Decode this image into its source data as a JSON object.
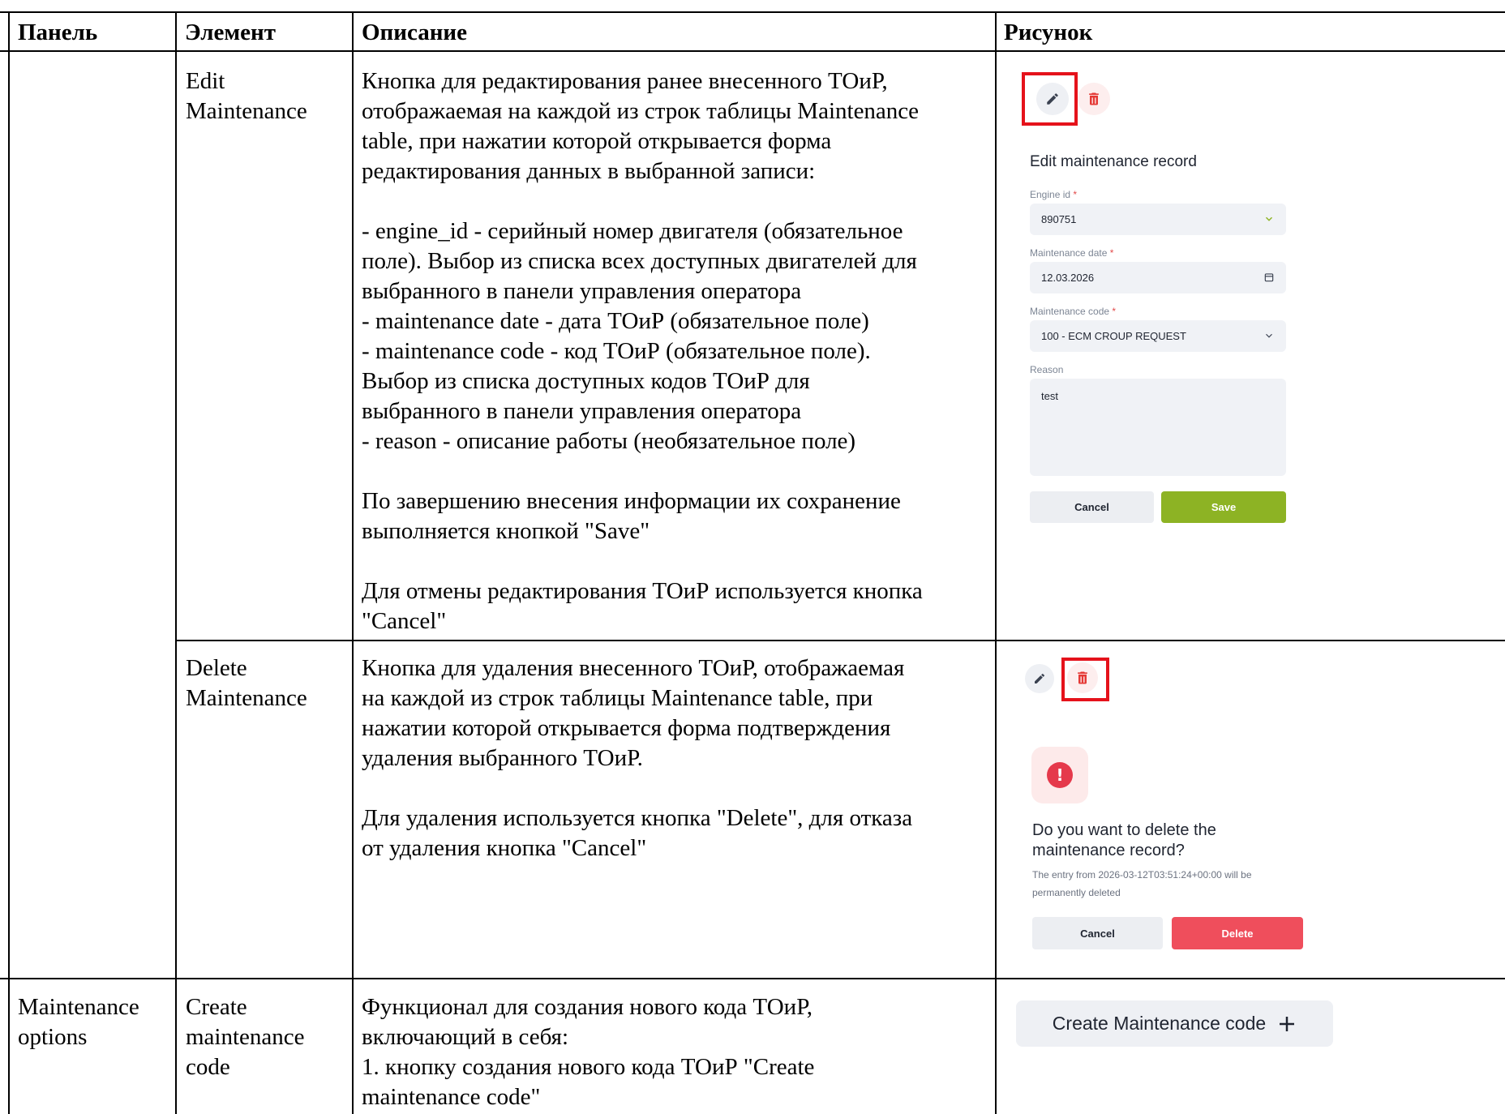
{
  "headers": {
    "panel": "Панель",
    "element": "Элемент",
    "description": "Описание",
    "picture": "Рисунок"
  },
  "rows": [
    {
      "panel": "",
      "element": "Edit\nMaintenance",
      "description": "Кнопка для редактирования ранее внесенного ТОиР,\nотображаемая на каждой из строк таблицы Maintenance\ntable, при нажатии которой открывается форма\nредактирования данных в выбранной записи:\n\n- engine_id - серийный номер двигателя (обязательное\nполе). Выбор из списка всех доступных двигателей для\nвыбранного в панели управления оператора\n- maintenance date - дата ТОиР (обязательное поле)\n- maintenance code - код ТОиР (обязательное поле).\nВыбор из списка доступных кодов ТОиР для\nвыбранного в панели управления оператора\n- reason - описание работы (необязательное поле)\n\nПо завершению внесения информации их сохранение\nвыполняется кнопкой \"Save\"\n\nДля отмены редактирования ТОиР используется кнопка\n\"Cancel\""
    },
    {
      "panel": "",
      "element": "Delete\nMaintenance",
      "description": "Кнопка для удаления внесенного ТОиР, отображаемая\nна каждой из строк таблицы Maintenance table, при\nнажатии которой открывается форма подтверждения\nудаления выбранного ТОиР.\n\nДля удаления используется кнопка \"Delete\", для отказа\nот удаления кнопка \"Cancel\""
    },
    {
      "panel": "Maintenance\noptions",
      "element": "Create\nmaintenance\ncode",
      "description": "Функционал для создания нового кода ТОиР,\nвключающий в себя:\n1. кнопку создания нового кода ТОиР \"Create\nmaintenance code\""
    }
  ],
  "edit_form": {
    "title": "Edit maintenance record",
    "engine_label": "Engine id",
    "engine_value": "890751",
    "date_label": "Maintenance date",
    "date_value": "12.03.2026",
    "code_label": "Maintenance code",
    "code_value": "100 - ECM CROUP REQUEST",
    "reason_label": "Reason",
    "reason_value": "test",
    "required_mark": "*",
    "cancel_label": "Cancel",
    "save_label": "Save"
  },
  "delete_dialog": {
    "title": "Do you want to delete the\nmaintenance record?",
    "message": "The entry from 2026-03-12T03:51:24+00:00 will be\npermanently deleted",
    "cancel_label": "Cancel",
    "delete_label": "Delete"
  },
  "create_code": {
    "label": "Create Maintenance code"
  },
  "colors": {
    "highlight": "#e5121b",
    "save_green": "#8db324",
    "delete_red": "#ef4e5c",
    "trash_red": "#e53935",
    "field_bg": "#f0f2f6"
  },
  "icons": [
    "pencil-icon",
    "trash-icon",
    "chevron-down-icon",
    "calendar-icon",
    "exclamation-icon",
    "plus-icon"
  ]
}
